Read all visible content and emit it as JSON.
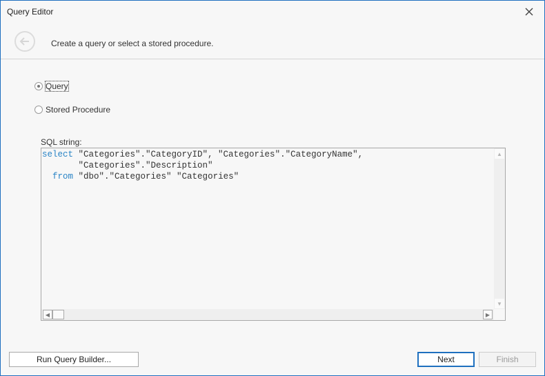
{
  "window": {
    "title": "Query Editor",
    "close_icon": "close-icon",
    "subtitle": "Create a query or select a stored procedure.",
    "back_icon": "back-arrow-icon"
  },
  "options": [
    {
      "label": "Query",
      "selected": true
    },
    {
      "label": "Stored Procedure",
      "selected": false
    }
  ],
  "sql": {
    "label": "SQL string:",
    "lines": [
      {
        "keyword": "select",
        "text": " \"Categories\".\"CategoryID\", \"Categories\".\"CategoryName\","
      },
      {
        "keyword": "",
        "text": "       \"Categories\".\"Description\""
      },
      {
        "indent": "  ",
        "keyword": "from",
        "text": " \"dbo\".\"Categories\" \"Categories\""
      }
    ]
  },
  "footer": {
    "run_builder": "Run Query Builder...",
    "next": "Next",
    "finish": "Finish"
  },
  "colors": {
    "accent": "#1e6fbf",
    "keyword": "#2a84c6"
  }
}
